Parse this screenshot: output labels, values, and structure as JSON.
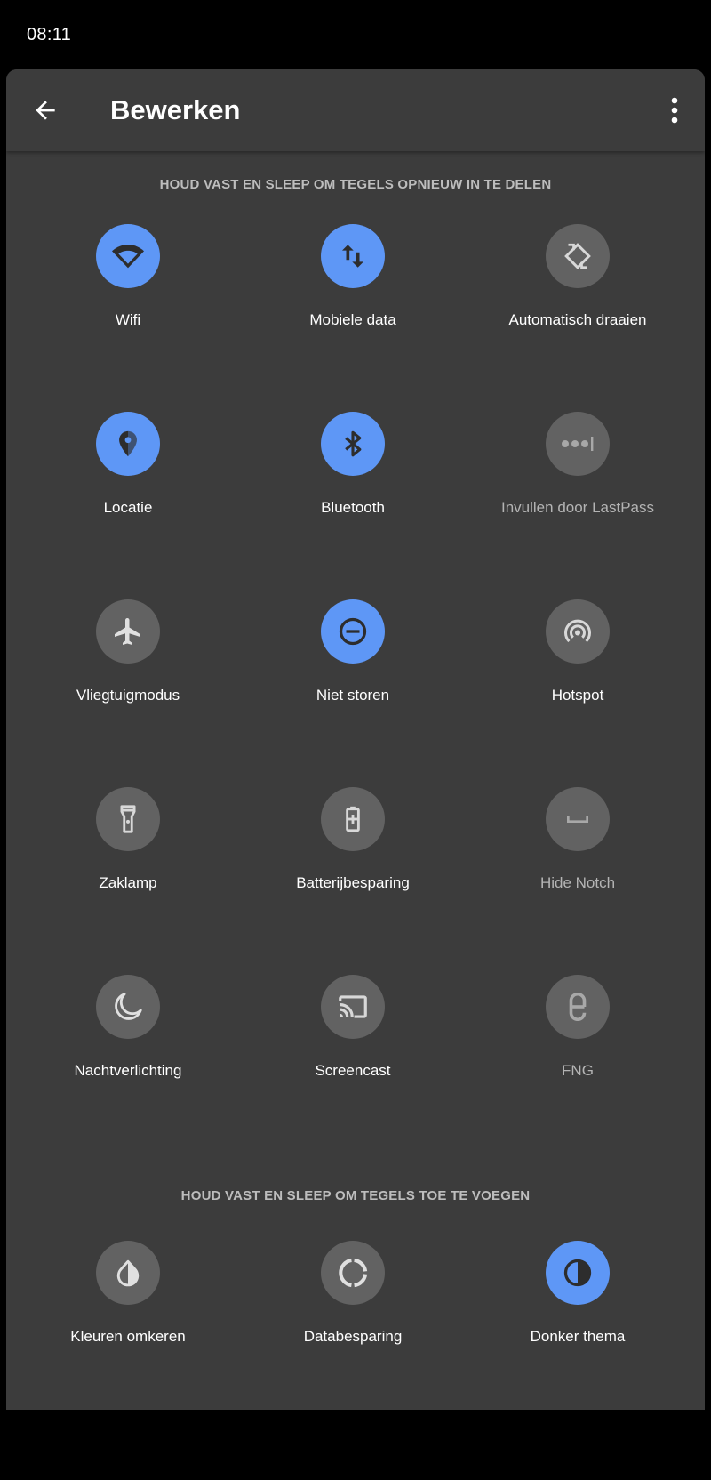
{
  "status_bar": {
    "time": "08:11"
  },
  "toolbar": {
    "back_icon": "arrow-left-icon",
    "title": "Bewerken",
    "more_icon": "more-vertical-icon"
  },
  "colors": {
    "active_tile": "#5e97f6",
    "inactive_tile": "#626262",
    "panel_background": "#3c3c3c"
  },
  "active_section": {
    "header": "HOUD VAST EN SLEEP OM TEGELS OPNIEUW IN TE DELEN",
    "tiles": [
      {
        "label": "Wifi",
        "icon": "wifi-icon",
        "active": true
      },
      {
        "label": "Mobiele data",
        "icon": "mobile-data-icon",
        "active": true
      },
      {
        "label": "Automatisch draaien",
        "icon": "auto-rotate-icon",
        "active": false
      },
      {
        "label": "Locatie",
        "icon": "location-icon",
        "active": true
      },
      {
        "label": "Bluetooth",
        "icon": "bluetooth-icon",
        "active": true
      },
      {
        "label": "Invullen door LastPass",
        "icon": "lastpass-icon",
        "active": false
      },
      {
        "label": "Vliegtuigmodus",
        "icon": "airplane-icon",
        "active": false
      },
      {
        "label": "Niet storen",
        "icon": "do-not-disturb-icon",
        "active": true
      },
      {
        "label": "Hotspot",
        "icon": "hotspot-icon",
        "active": false
      },
      {
        "label": "Zaklamp",
        "icon": "flashlight-icon",
        "active": false
      },
      {
        "label": "Batterijbesparing",
        "icon": "battery-saver-icon",
        "active": false
      },
      {
        "label": "Hide Notch",
        "icon": "hide-notch-icon",
        "active": false
      },
      {
        "label": "Nachtverlichting",
        "icon": "night-light-icon",
        "active": false
      },
      {
        "label": "Screencast",
        "icon": "cast-icon",
        "active": false
      },
      {
        "label": "FNG",
        "icon": "fng-icon",
        "active": false
      }
    ]
  },
  "available_section": {
    "header": "HOUD VAST EN SLEEP OM TEGELS TOE TE VOEGEN",
    "tiles": [
      {
        "label": "Kleuren omkeren",
        "icon": "invert-colors-icon",
        "active": false
      },
      {
        "label": "Databesparing",
        "icon": "data-saver-icon",
        "active": false
      },
      {
        "label": "Donker thema",
        "icon": "dark-theme-icon",
        "active": true
      }
    ]
  }
}
